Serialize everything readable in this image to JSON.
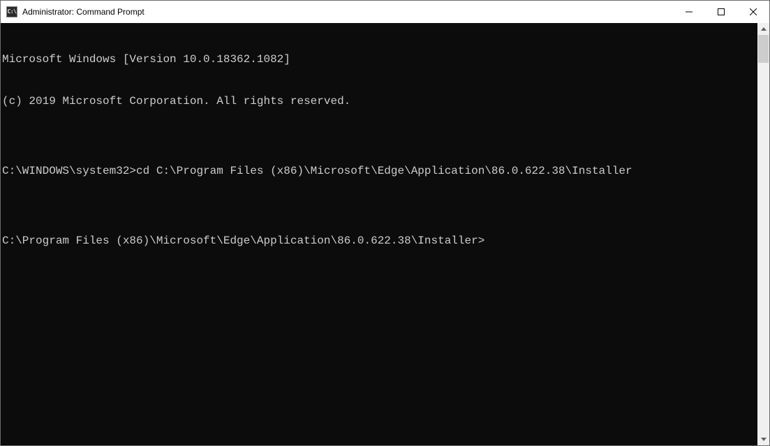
{
  "window": {
    "title": "Administrator: Command Prompt",
    "icon_label": "C:\\"
  },
  "terminal": {
    "lines": [
      "Microsoft Windows [Version 10.0.18362.1082]",
      "(c) 2019 Microsoft Corporation. All rights reserved.",
      "",
      "C:\\WINDOWS\\system32>cd C:\\Program Files (x86)\\Microsoft\\Edge\\Application\\86.0.622.38\\Installer",
      "",
      "C:\\Program Files (x86)\\Microsoft\\Edge\\Application\\86.0.622.38\\Installer>"
    ]
  }
}
